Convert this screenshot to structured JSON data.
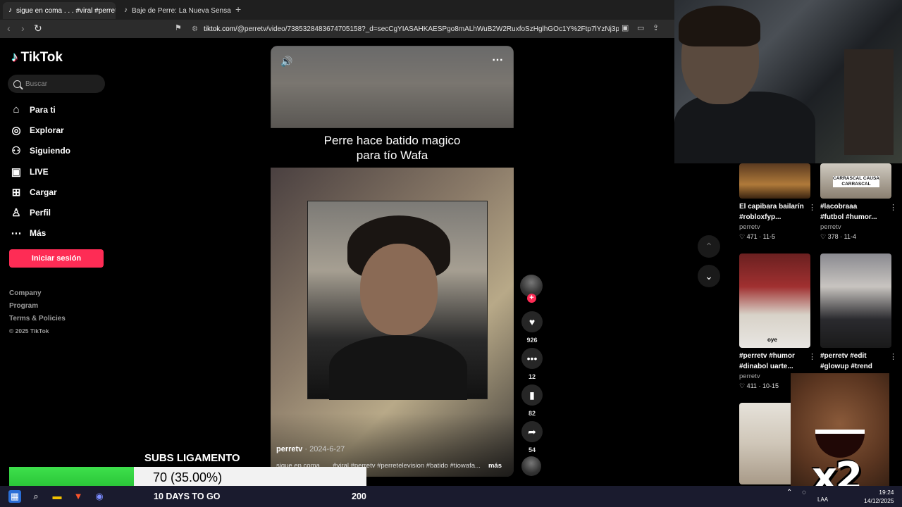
{
  "browser": {
    "tabs": [
      {
        "title": "sigue en coma . . . #viral #perret",
        "active": true
      },
      {
        "title": "Baje de Perre: La Nueva Sensación en",
        "active": false
      }
    ],
    "new_tab": "+",
    "url": {
      "domain": "tiktok.com",
      "path": "/@perretv/video/7385328483674705158?_d=secCgYIASAHKAESPgo8mALhWuB2W2RuxfoSzHglhGOc1Y%2Ftp7lYzNj3p%2BuZQ..."
    }
  },
  "sidebar": {
    "logo": "TikTok",
    "search_placeholder": "Buscar",
    "nav": [
      {
        "label": "Para ti",
        "icon": "home-icon"
      },
      {
        "label": "Explorar",
        "icon": "compass-icon"
      },
      {
        "label": "Siguiendo",
        "icon": "following-icon"
      },
      {
        "label": "LIVE",
        "icon": "live-icon"
      },
      {
        "label": "Cargar",
        "icon": "upload-icon"
      },
      {
        "label": "Perfil",
        "icon": "profile-icon"
      },
      {
        "label": "Más",
        "icon": "more-icon"
      }
    ],
    "login_label": "Iniciar sesión",
    "footer": [
      "Company",
      "Program",
      "Terms & Policies"
    ],
    "copyright": "© 2025 TikTok"
  },
  "video": {
    "caption_line1": "Perre hace batido magico",
    "caption_line2": "para tío Wafa",
    "author": "perretv",
    "date": "· 2024-6-27",
    "description": "sigue en coma . . . #viral #perretv #perretelevision #batido #tiowafa...",
    "more_label": "más"
  },
  "actions": {
    "likes": "926",
    "comments": "12",
    "saves": "82",
    "shares": "54"
  },
  "grid": [
    {
      "title1": "El capibara bailarín",
      "title2": "#robloxfyp...",
      "user": "perretv",
      "likes": "471",
      "date": "11-5"
    },
    {
      "title1": "#lacobraaa",
      "title2": "#futbol #humor...",
      "user": "perretv",
      "likes": "378",
      "date": "11-4",
      "thumb_text": "CARRASCAL CAUSA CARRASCAL"
    },
    {
      "title1": "#perretv #humor",
      "title2": "#dinabol uarte...",
      "user": "perretv",
      "likes": "411",
      "date": "10-15",
      "thumb_text": "oye"
    },
    {
      "title1": "#perretv #edit",
      "title2": "#glowup #trend",
      "user": "",
      "likes": "",
      "date": ""
    }
  ],
  "overlay": {
    "goal_title": "SUBS LIGAMENTO",
    "goal_progress_text": "70 (35.00%)",
    "goal_fraction": 0.35,
    "goal_days": "10 DAYS TO GO",
    "goal_target": "200",
    "meme_text": "x2"
  },
  "taskbar": {
    "tray_label": "LAA",
    "time": "19:24",
    "date": "14/12/2025"
  },
  "colors": {
    "accent": "#fe2c55",
    "goal_green": "#3ee04c"
  }
}
